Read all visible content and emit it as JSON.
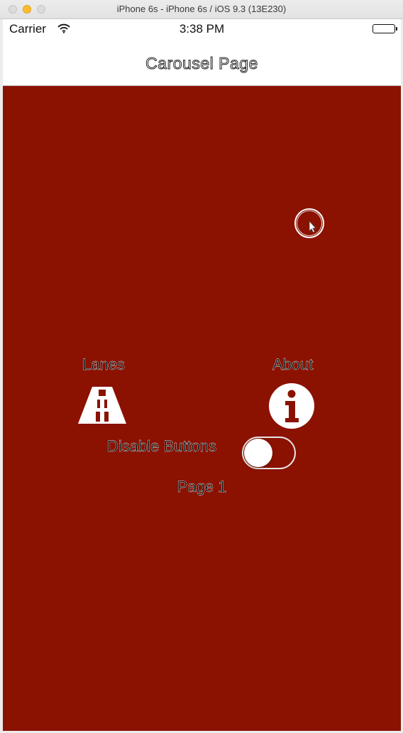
{
  "window": {
    "title": "iPhone 6s - iPhone 6s / iOS 9.3 (13E230)"
  },
  "statusbar": {
    "carrier": "Carrier",
    "time": "3:38 PM"
  },
  "navbar": {
    "title": "Carousel Page"
  },
  "content": {
    "background_color": "#8b1100",
    "lanes_label": "Lanes",
    "about_label": "About",
    "disable_label": "Disable Buttons",
    "disable_toggle_on": false,
    "page_label": "Page 1"
  },
  "icons": {
    "lanes": "road-lanes-icon",
    "about": "info-icon",
    "wifi": "wifi-icon",
    "battery": "battery-icon"
  }
}
